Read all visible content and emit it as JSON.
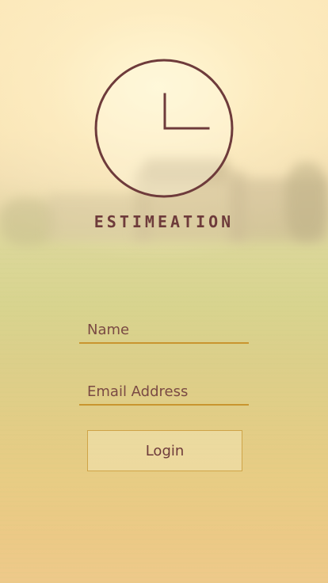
{
  "app": {
    "brand_name": "ESTIMEATION"
  },
  "form": {
    "name_placeholder": "Name",
    "email_placeholder": "Email Address",
    "login_label": "Login"
  },
  "colors": {
    "brand": "#6e3b3b",
    "underline": "#c9952f",
    "button_border": "#cfa448"
  },
  "icons": {
    "logo": "clock-icon"
  }
}
